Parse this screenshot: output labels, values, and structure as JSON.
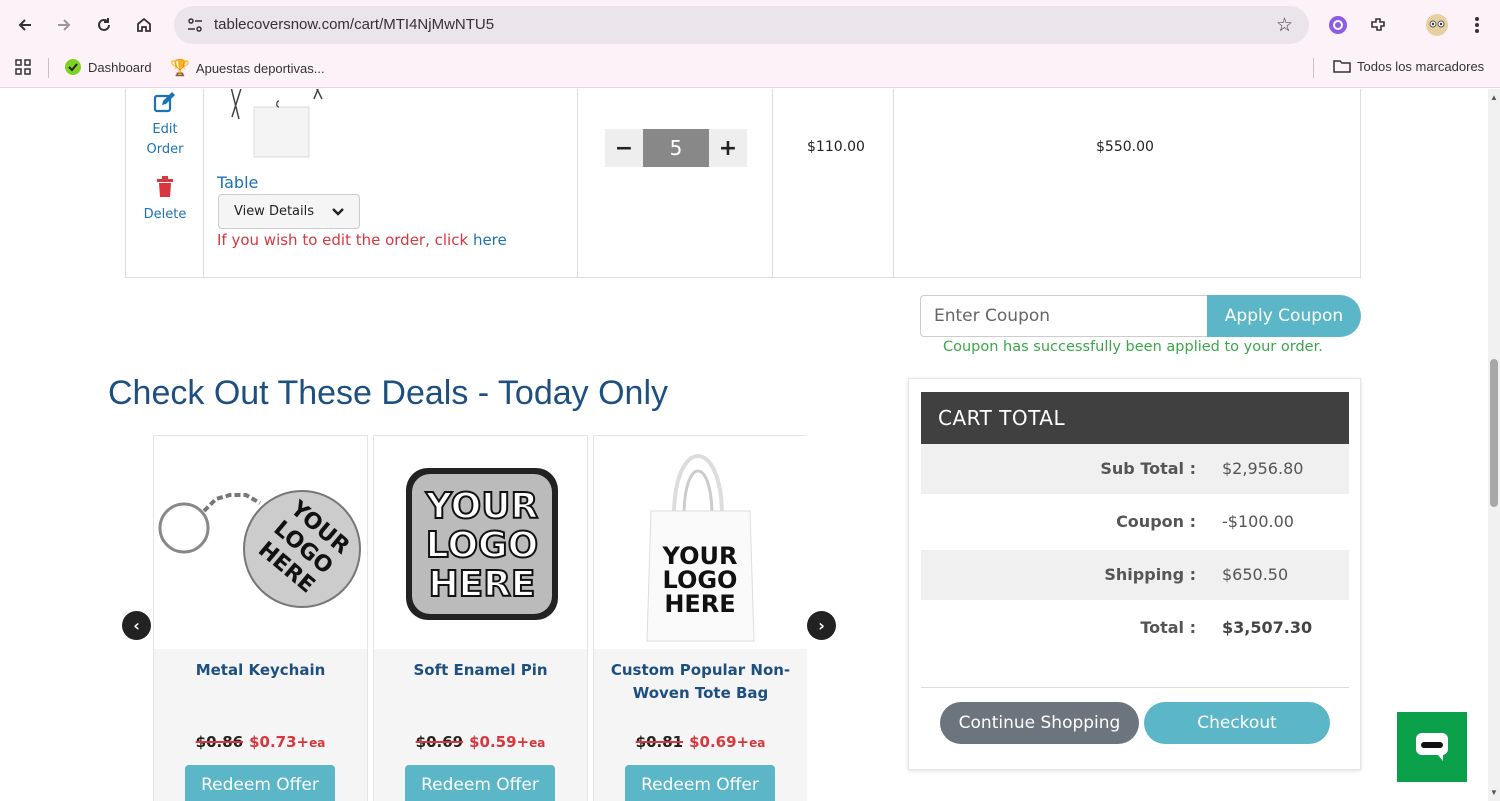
{
  "browser": {
    "url": "tablecoversnow.com/cart/MTI4NjMwNTU5",
    "bookmarks": [
      "Dashboard",
      "Apuestas deportivas..."
    ],
    "all_bookmarks": "Todos los marcadores"
  },
  "cart_item": {
    "edit_label_1": "Edit",
    "edit_label_2": "Order",
    "delete_label": "Delete",
    "product_name": "Table",
    "view_details": "View Details",
    "edit_note": "If you wish to edit the order, click ",
    "edit_link": "here",
    "minus": "−",
    "quantity": "5",
    "plus": "+",
    "unit_price": "$110.00",
    "line_total": "$550.00"
  },
  "coupon": {
    "placeholder": "Enter Coupon",
    "button": "Apply Coupon",
    "message": "Coupon has successfully been applied to your order."
  },
  "deals": {
    "title": "Check Out These Deals - Today Only",
    "items": [
      {
        "name": "Metal Keychain",
        "old_price": "$0.86",
        "new_price": "$0.73+",
        "unit": "ea",
        "button": "Redeem Offer",
        "logo_text": [
          "YOUR",
          "LOGO",
          "HERE"
        ]
      },
      {
        "name": "Soft Enamel Pin",
        "old_price": "$0.69",
        "new_price": "$0.59+",
        "unit": "ea",
        "button": "Redeem Offer",
        "logo_text": [
          "YOUR",
          "LOGO",
          "HERE"
        ]
      },
      {
        "name": "Custom Popular Non-Woven Tote Bag",
        "old_price": "$0.81",
        "new_price": "$0.69+",
        "unit": "ea",
        "button": "Redeem Offer",
        "logo_text": [
          "YOUR",
          "LOGO",
          "HERE"
        ]
      }
    ]
  },
  "cart_total": {
    "heading": "CART  TOTAL",
    "rows": [
      {
        "label": "Sub Total :",
        "value": "$2,956.80"
      },
      {
        "label": "Coupon :",
        "value": "-$100.00"
      },
      {
        "label": "Shipping :",
        "value": "$650.50"
      },
      {
        "label": "Total :",
        "value": "$3,507.30"
      }
    ],
    "continue_button": "Continue Shopping",
    "checkout_button": "Checkout"
  },
  "colors": {
    "accent": "#5bb7c8",
    "title_blue": "#1d4f80",
    "link_blue": "#1a73b8",
    "error_red": "#d9363e",
    "success_green": "#3aa64a",
    "chat_green": "#0aa04a"
  }
}
